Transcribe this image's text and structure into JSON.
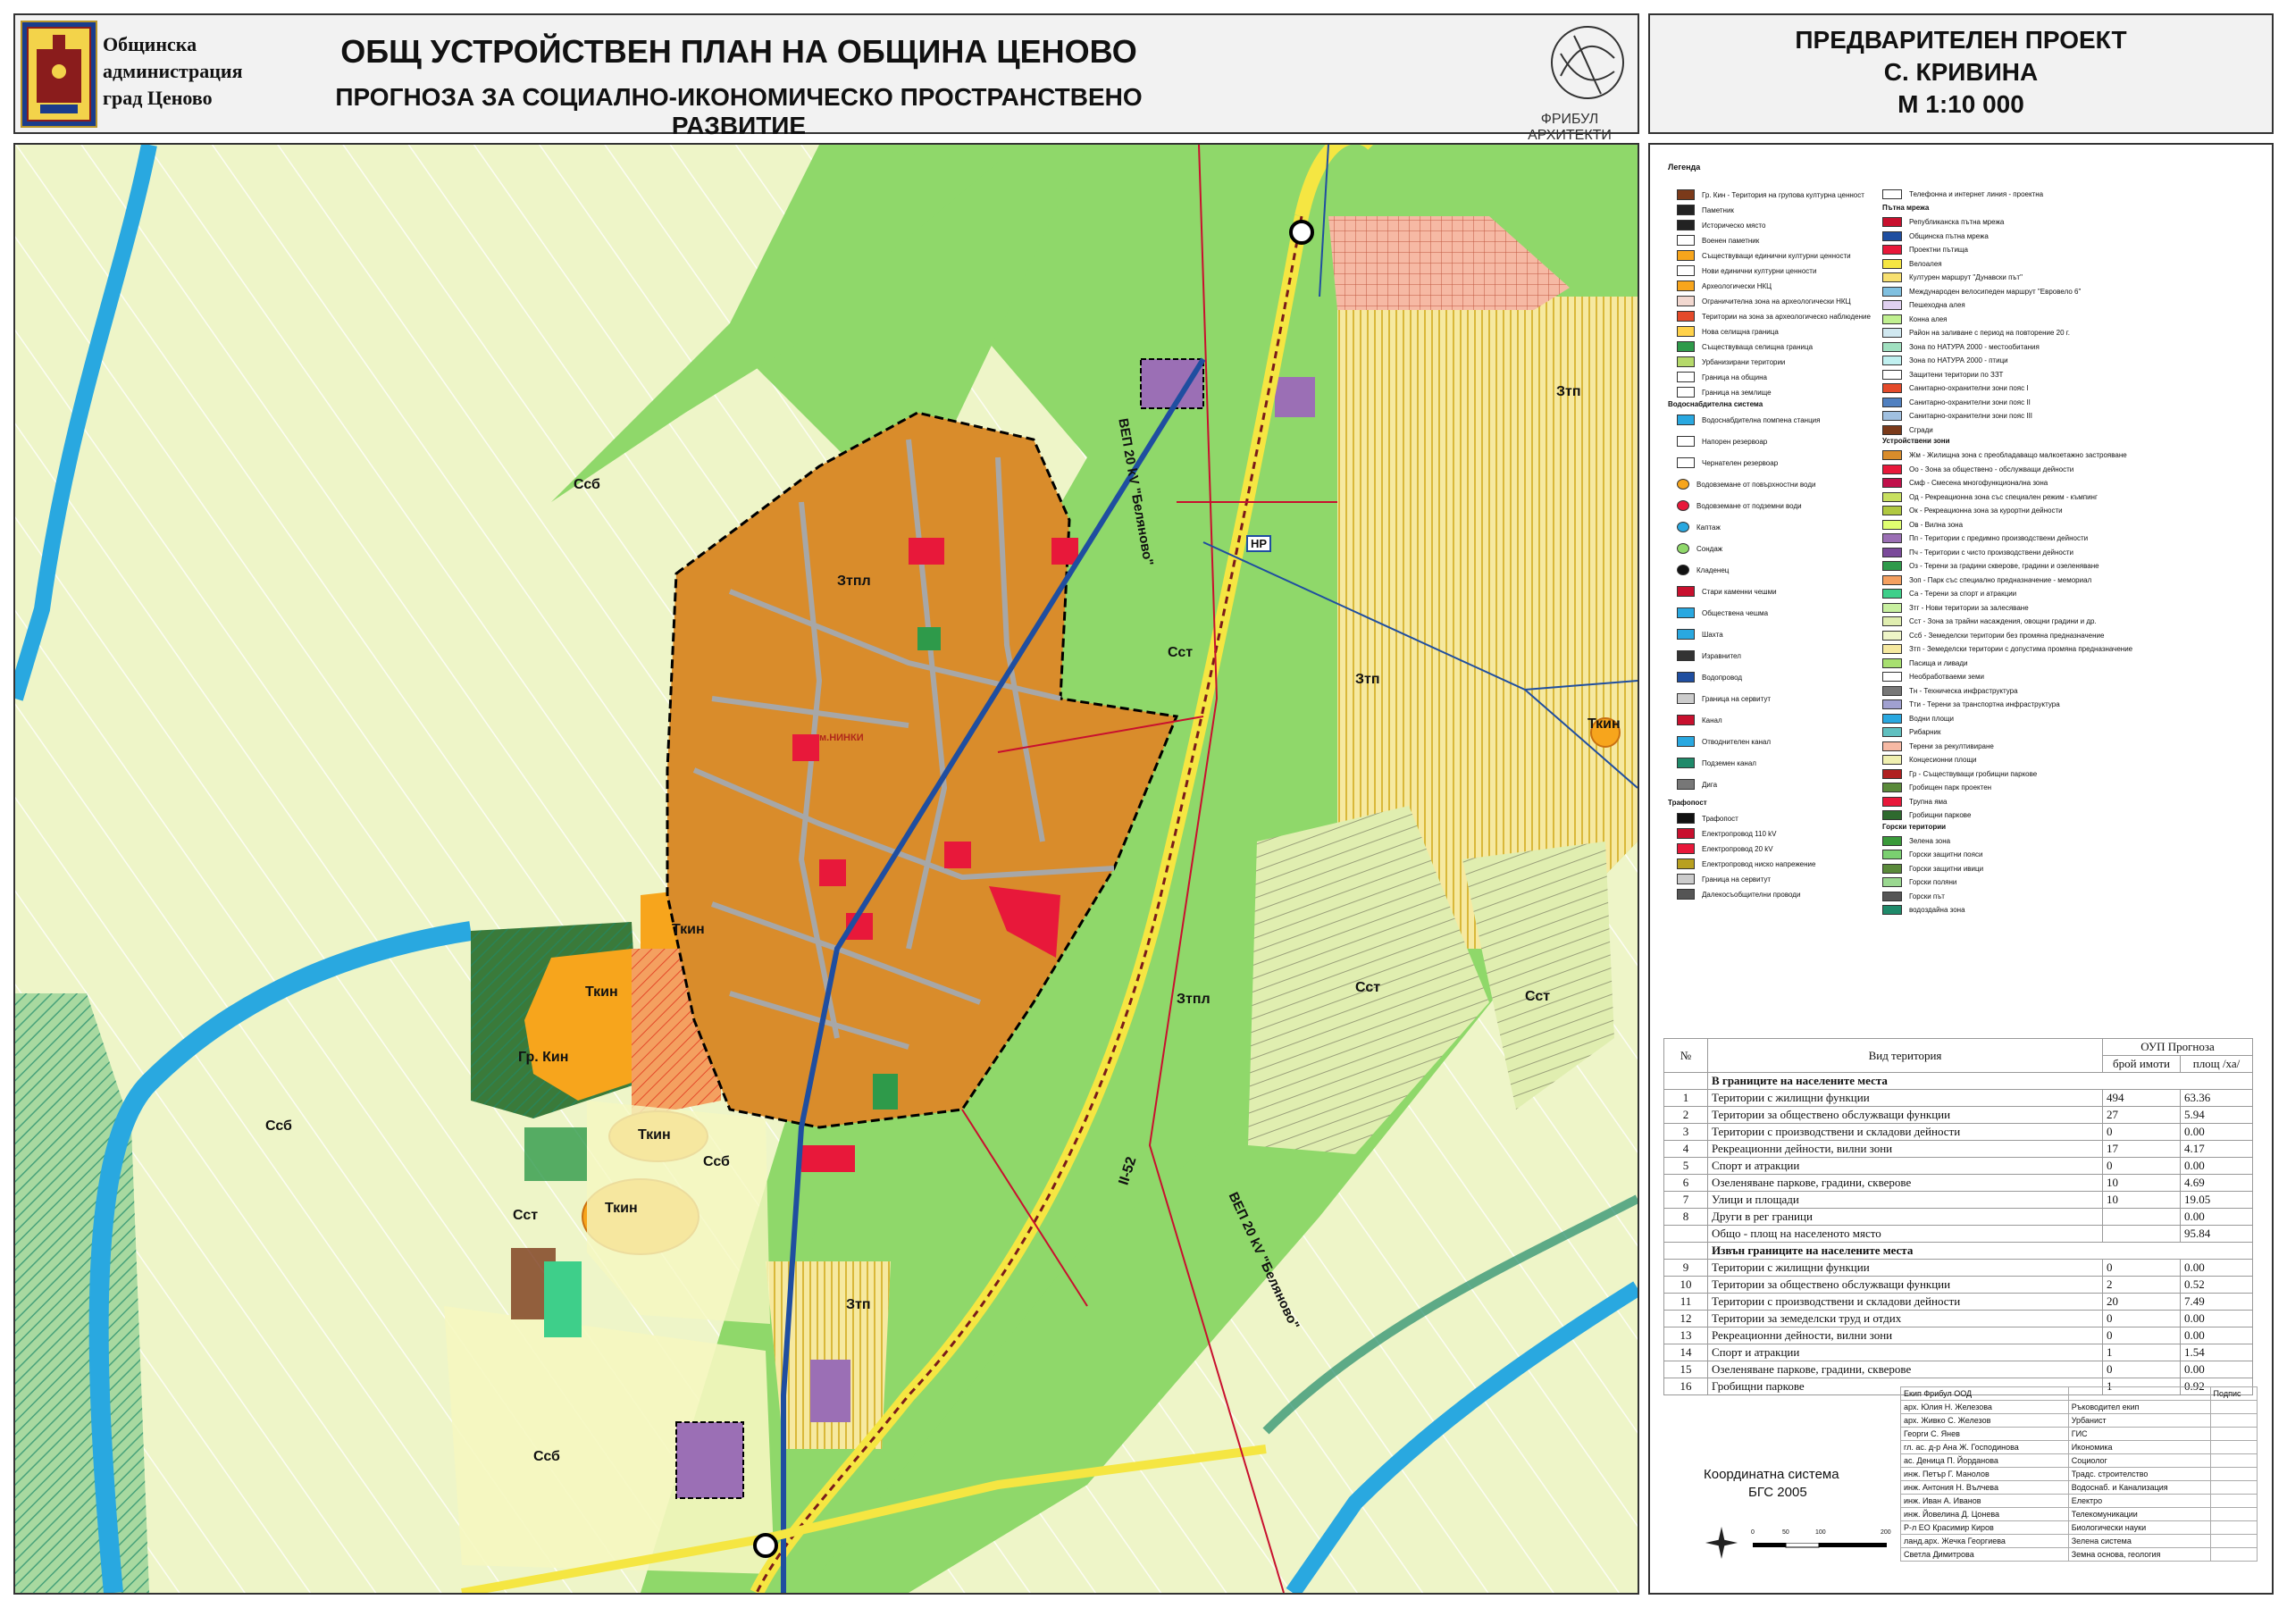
{
  "header": {
    "admin_line1": "Общинска",
    "admin_line2": "администрация",
    "admin_line3": "град Ценово",
    "title": "ОБЩ УСТРОЙСТВЕН ПЛАН НА ОБЩИНА ЦЕНОВО",
    "subtitle": "ПРОГНОЗА ЗА СОЦИАЛНО-ИКОНОМИЧЕСКО ПРОСТРАНСТВЕНО РАЗВИТИЕ",
    "firm": "ФРИБУЛ АРХИТЕКТИ",
    "project_line1": "ПРЕДВАРИТЕЛЕН ПРОЕКТ",
    "project_line2": "С. КРИВИНА",
    "project_line3": "М 1:10 000"
  },
  "map_labels": {
    "ssb1": "Ссб",
    "ssb2": "Ссб",
    "ssb3": "Ссб",
    "ssb4": "Ссб",
    "ztp1": "Зтп",
    "ztp2": "Зтп",
    "ztp3": "Зтп",
    "ztpl1": "Зтпл",
    "ztpl2": "Зтпл",
    "sst1": "Сст",
    "sst2": "Сст",
    "sst3": "Сст",
    "sst4": "Сст",
    "tkin1": "Ткин",
    "tkin2": "Ткин",
    "tkin3": "Ткин",
    "tkin4": "Ткин",
    "tkin5": "Ткин",
    "gr_kin": "Гр. Кин",
    "np": "НР",
    "road": "II-52",
    "vep1": "ВЕП 20 kV \"Беляново\"",
    "vep2": "ВЕП 20 kV \"Беляново\"",
    "neighborhood": "м.НИНКИ"
  },
  "legend": {
    "title": "Легенда",
    "left_items": [
      "Гр. Кин - Територия на групова културна ценност",
      "Паметник",
      "Историческо място",
      "Военен паметник",
      "Съществуващи единични културни ценности",
      "Нови единични културни ценности",
      "Археологически НКЦ",
      "Ограничителна зона на археологически НКЦ",
      "Територии на зона за археологическо наблюдение",
      "Нова селищна граница",
      "Съществуваща селищна граница",
      "Урбанизирани територии",
      "Граница на община",
      "Граница на землище"
    ],
    "water_head": "Водоснабдителна система",
    "water_items": [
      "Водоснабдителна помпена станция",
      "Напорен резервоар",
      "Чернателен резервоар",
      "Водовземане от повърхностни води",
      "Водовземане от подземни води",
      "Каптаж",
      "Сондаж",
      "Кладенец",
      "Стари каменни чешми",
      "Обществена чешма",
      "Шахта",
      "Изравнител",
      "Водопровод",
      "Граница на сервитут",
      "Канал",
      "Отводнителен канал",
      "Подземен канал",
      "Дига"
    ],
    "electric_head": "Трафопост",
    "electric_items": [
      "Трафопост",
      "Електропровод 110 kV",
      "Електропровод 20 kV",
      "Електропровод ниско напрежение",
      "Граница на сервитут",
      "Далекосъобщителни проводи"
    ],
    "right_top": "Телефонна и интернет линия - проектна",
    "road_head": "Пътна мрежа",
    "road_items": [
      "Републиканска пътна мрежа",
      "Общинска пътна мрежа",
      "Проектни пътища",
      "Велоалея",
      "Културен маршрут \"Дунавски път\"",
      "Международен велосипеден маршрут \"Евровело 6\"",
      "Пешеходна алея",
      "Конна алея",
      "Район на заливане с период на повторение 20 г.",
      "Зона по НАТУРА 2000 - местообитания",
      "Зона по НАТУРА 2000 - птици",
      "Защитени територии по ЗЗТ",
      "Санитарно-охранителни зони пояс I",
      "Санитарно-охранителни зони пояс II",
      "Санитарно-охранителни зони пояс III",
      "Сгради"
    ],
    "zones_head": "Устройствени зони",
    "zone_items": [
      "Жм - Жилищна зона с преобладаващо малкоетажно застрояване",
      "Оо - Зона за обществено - обслужващи дейности",
      "Смф - Смесена многофункционална зона",
      "Од - Рекреационна зона със специален режим - къмпинг",
      "Ок - Рекреационна зона за курортни дейности",
      "Ов - Вилна зона",
      "Пп - Територии с предимно производствени дейности",
      "Пч - Територии с чисто производствени дейности",
      "Оз - Терени за градини скверове, градини и озеленяване",
      "Зоп - Парк със специално предназначение - мемориал",
      "Са - Терени за спорт и атракции",
      "Зтг - Нови територии за залесяване",
      "Сст - Зона за трайни насаждения, овощни градини и др.",
      "Ссб - Земеделски територии без промяна предназначение",
      "Зтп - Земеделски територии с допустима промяна предназначение",
      "Пасища и ливади",
      "Необработваеми земи",
      "Тн - Техническа инфраструктура",
      "Тти - Терени за транспортна инфраструктура",
      "Водни площи",
      "Рибарник",
      "Терени за рекултивиране",
      "Концесионни площи",
      "Гр - Съществуващи гробищни паркове",
      "Гробищен парк проектен",
      "Трупна яма",
      "Гробищни паркове"
    ],
    "forest_head": "Горски територии",
    "forest_items": [
      "Зелена зона",
      "Горски защитни пояси",
      "Горски защитни ивици",
      "Горски поляни",
      "Горски път",
      "водоздайна зона"
    ]
  },
  "table": {
    "col_no": "№",
    "col_type": "Вид територия",
    "col_group": "ОУП Прогноза",
    "col_count": "брой имоти",
    "col_area": "площ /ха/",
    "section1": "В границите на населените места",
    "rows1": [
      {
        "no": "1",
        "name": "Територии с жилищни функции",
        "count": "494",
        "area": "63.36"
      },
      {
        "no": "2",
        "name": "Територии за обществено обслужващи функции",
        "count": "27",
        "area": "5.94"
      },
      {
        "no": "3",
        "name": "Територии с производствени и складови дейности",
        "count": "0",
        "area": "0.00"
      },
      {
        "no": "4",
        "name": "Рекреационни дейности, вилни зони",
        "count": "17",
        "area": "4.17"
      },
      {
        "no": "5",
        "name": "Спорт и атракции",
        "count": "0",
        "area": "0.00"
      },
      {
        "no": "6",
        "name": "Озеленяване паркове, градини, скверове",
        "count": "10",
        "area": "4.69"
      },
      {
        "no": "7",
        "name": "Улици и площади",
        "count": "10",
        "area": "19.05"
      },
      {
        "no": "8",
        "name": "Други в рег граници",
        "count": "",
        "area": "0.00"
      }
    ],
    "total_label": "Общо - площ на населеното място",
    "total_area": "95.84",
    "section2": "Извън границите на населените места",
    "rows2": [
      {
        "no": "9",
        "name": "Територии с жилищни функции",
        "count": "0",
        "area": "0.00"
      },
      {
        "no": "10",
        "name": "Територии за обществено обслужващи функции",
        "count": "2",
        "area": "0.52"
      },
      {
        "no": "11",
        "name": "Територии с производствени и складови дейности",
        "count": "20",
        "area": "7.49"
      },
      {
        "no": "12",
        "name": "Територии за земеделски труд и отдих",
        "count": "0",
        "area": "0.00"
      },
      {
        "no": "13",
        "name": "Рекреационни дейности, вилни зони",
        "count": "0",
        "area": "0.00"
      },
      {
        "no": "14",
        "name": "Спорт и атракции",
        "count": "1",
        "area": "1.54"
      },
      {
        "no": "15",
        "name": "Озеленяване паркове, градини, скверове",
        "count": "0",
        "area": "0.00"
      },
      {
        "no": "16",
        "name": "Гробищни паркове",
        "count": "1",
        "area": "0.92"
      }
    ]
  },
  "team": {
    "head": "Екип Фрибул ООД",
    "sign": "Подпис",
    "members": [
      {
        "name": "арх. Юлия Н. Железова",
        "role": "Ръководител екип"
      },
      {
        "name": "арх. Живко С. Железов",
        "role": "Урбанист"
      },
      {
        "name": "Георги С. Янев",
        "role": "ГИС"
      },
      {
        "name": "гл. ас. д-р Ана Ж. Господинова",
        "role": "Икономика"
      },
      {
        "name": "ас. Деница П. Йорданова",
        "role": "Социолог"
      },
      {
        "name": "инж. Петър Г. Манолов",
        "role": "Традс. строителство"
      },
      {
        "name": "инж. Антония Н. Вълчева",
        "role": "Водоснаб. и Канализация"
      },
      {
        "name": "инж. Иван А. Иванов",
        "role": "Електро"
      },
      {
        "name": "инж. Йовелина Д. Цонева",
        "role": "Телекомуникации"
      },
      {
        "name": "Р-л ЕО Красимир Киров",
        "role": "Биологически науки"
      },
      {
        "name": "ланд.арх. Жечка Георгиева",
        "role": "Зелена система"
      },
      {
        "name": "Светла Димитрова",
        "role": "Земна основа, геология"
      }
    ]
  },
  "coords": {
    "line1": "Координатна система",
    "line2": "БГС 2005"
  },
  "scale": {
    "t0": "0",
    "t1": "50",
    "t2": "100",
    "t3": "200"
  },
  "colors": {
    "residential": "#d98c2b",
    "public": "#e8183a",
    "agri": "#e7f1c0",
    "green": "#8fd86a",
    "water": "#29a8e0",
    "road": "#f5e642",
    "tkin": "#f7a51c",
    "production": "#9b6fb5"
  }
}
